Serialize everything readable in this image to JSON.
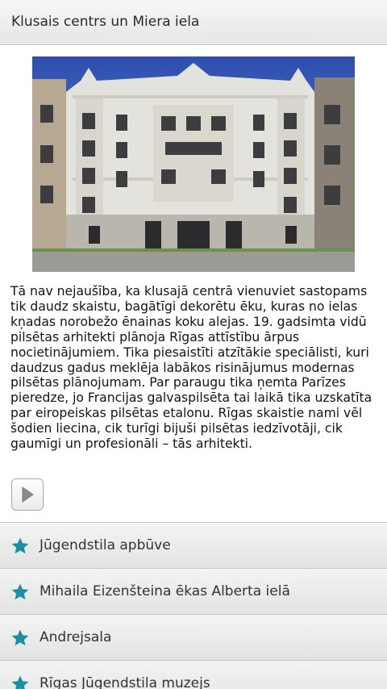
{
  "header": {
    "title": "Klusais centrs un Miera iela"
  },
  "photo": {
    "alt": "",
    "icon": "building-photo"
  },
  "description": "Tā nav nejaušība, ka klusajā centrā vienuviet sastopams tik daudz skaistu, bagātīgi dekorētu ēku, kuras no ielas kņadas norobežo ēnainas koku alejas. 19. gadsimta vidū pilsētas arhitekti plānoja Rīgas attīstību ārpus nocietinājumiem. Tika piesaistīti atzītākie speciālisti, kuri daudzus gadus meklēja labākos risinājumus modernas pilsētas plānojumam. Par paraugu tika ņemta Parīzes pieredze, jo Francijas galvaspilsēta tai laikā tika uzskatīta par eiropeiskas pilsētas etalonu. Rīgas skaistie nami vēl šodien liecina, cik turīgi bijuši pilsētas iedzīvotāji, cik gaumīgi un profesionāli – tās arhitekti.",
  "controls": {
    "play_icon": "play-icon"
  },
  "list": {
    "icon": "star-icon",
    "icon_color": "#1e8fa3",
    "items": [
      {
        "label": "Jūgendstila apbūve"
      },
      {
        "label": "Mihaila Eizenšteina ēkas Alberta ielā"
      },
      {
        "label": "Andrejsala"
      },
      {
        "label": "Rīgas Jūgendstila muzejs"
      }
    ]
  }
}
